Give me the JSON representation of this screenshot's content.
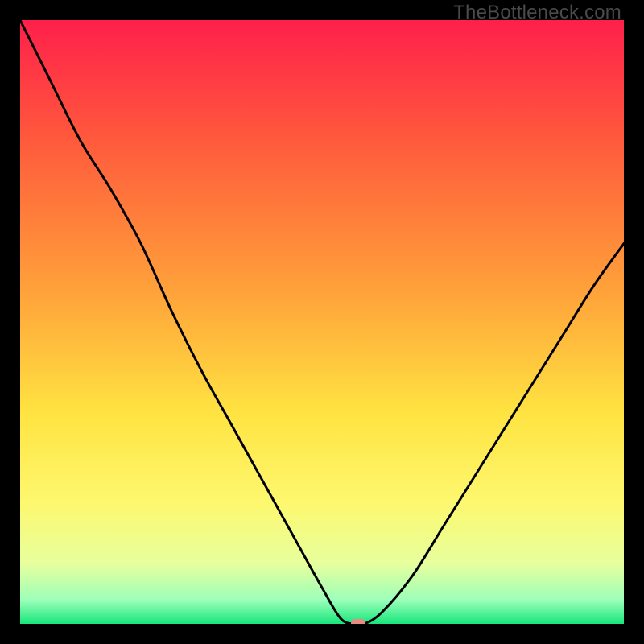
{
  "watermark": "TheBottleneck.com",
  "chart_data": {
    "type": "line",
    "title": "",
    "xlabel": "",
    "ylabel": "",
    "xlim": [
      0,
      100
    ],
    "ylim": [
      0,
      100
    ],
    "series": [
      {
        "name": "bottleneck-curve",
        "x": [
          0,
          5,
          10,
          15,
          20,
          25,
          30,
          35,
          40,
          45,
          50,
          53,
          55,
          57,
          60,
          65,
          70,
          75,
          80,
          85,
          90,
          95,
          100
        ],
        "y": [
          100,
          90,
          80,
          72,
          63,
          52,
          42,
          33,
          24,
          15,
          6,
          1,
          0,
          0,
          2,
          8,
          16,
          24,
          32,
          40,
          48,
          56,
          63
        ]
      }
    ],
    "marker": {
      "x": 56,
      "y": 0,
      "color": "#e98b82"
    },
    "gradient_stops": [
      {
        "offset": 0.0,
        "color": "#ff1f4b"
      },
      {
        "offset": 0.2,
        "color": "#ff5a3c"
      },
      {
        "offset": 0.45,
        "color": "#ffa23a"
      },
      {
        "offset": 0.65,
        "color": "#ffe341"
      },
      {
        "offset": 0.8,
        "color": "#fdf86f"
      },
      {
        "offset": 0.9,
        "color": "#e7ff9d"
      },
      {
        "offset": 0.96,
        "color": "#9dffb9"
      },
      {
        "offset": 1.0,
        "color": "#18e67d"
      }
    ]
  }
}
